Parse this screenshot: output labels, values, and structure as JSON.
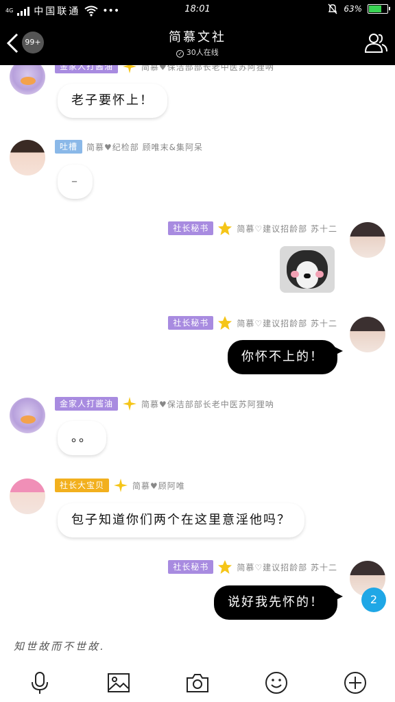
{
  "status_bar": {
    "carrier": "中国联通",
    "network_label": "4G",
    "dots": "•••",
    "time": "18:01",
    "battery_percent": "63%",
    "battery_level": 0.63
  },
  "nav": {
    "unread_badge": "99+",
    "title": "简慕文社",
    "subtitle": "30人在线"
  },
  "messages": [
    {
      "tag": "金家人打酱油",
      "nick": "简慕♥保洁部部长老中医苏阿狸呐",
      "text": "老子要怀上！"
    },
    {
      "tag": "吐槽",
      "nick": "简慕♥纪检部 顾唯末&集阿呆",
      "text": "–"
    },
    {
      "tag": "社长秘书",
      "nick": "简慕♡建议招龄部 苏十二",
      "image_alt": "sticker"
    },
    {
      "tag": "社长秘书",
      "nick": "简慕♡建议招龄部 苏十二",
      "text": "你怀不上的！"
    },
    {
      "tag": "金家人打酱油",
      "nick": "简慕♥保洁部部长老中医苏阿狸呐",
      "text": "。。"
    },
    {
      "tag": "社长大宝贝",
      "nick": "简慕♥顾阿唯",
      "text": "包子知道你们两个在这里意淫他吗？"
    },
    {
      "tag": "社长秘书",
      "nick": "简慕♡建议招龄部 苏十二",
      "text": "说好我先怀的！"
    }
  ],
  "unread_count": "2",
  "input": {
    "placeholder": "知世故而不世故."
  },
  "colors": {
    "accent_blue": "#1fa7e6",
    "tag_purple": "#a88be0",
    "tag_gold": "#f2b01e",
    "tag_blue": "#8ab8e8"
  },
  "icons": [
    "microphone-icon",
    "image-icon",
    "camera-icon",
    "emoji-icon",
    "plus-icon"
  ]
}
